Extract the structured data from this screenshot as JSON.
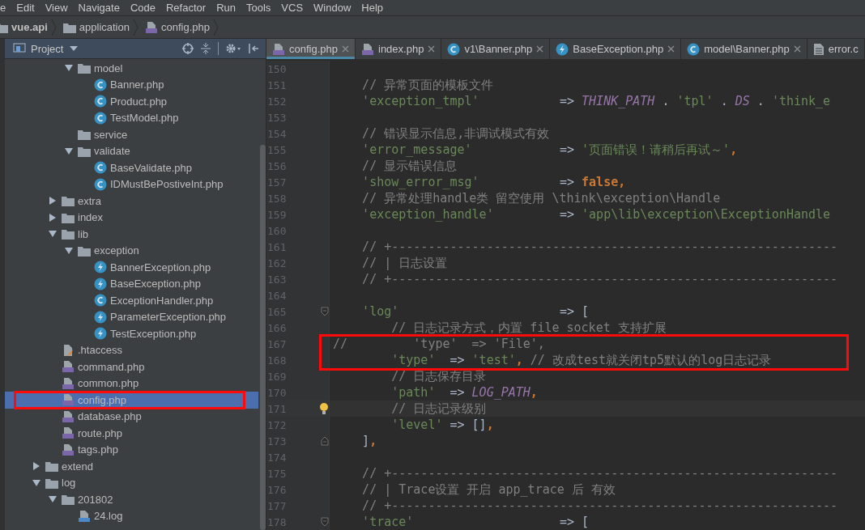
{
  "menu": [
    "e",
    "Edit",
    "View",
    "Navigate",
    "Code",
    "Refactor",
    "Run",
    "Tools",
    "VCS",
    "Window",
    "Help"
  ],
  "breadcrumb": [
    {
      "label": "vue.api",
      "kind": "project"
    },
    {
      "label": "application",
      "kind": "folder"
    },
    {
      "label": "config.php",
      "kind": "php"
    }
  ],
  "project_panel": {
    "title": "Project"
  },
  "tree": [
    {
      "children": [
        {
          "children": [
            {
              "label": "model",
              "kind": "folder",
              "expanded": true,
              "selected": false,
              "children": [
                {
                  "label": "Banner.php",
                  "kind": "class",
                  "selected": false
                },
                {
                  "label": "Product.php",
                  "kind": "class",
                  "selected": false
                },
                {
                  "label": "TestModel.php",
                  "kind": "class",
                  "selected": false
                }
              ]
            },
            {
              "label": "service",
              "kind": "folder",
              "selected": false
            },
            {
              "label": "validate",
              "kind": "folder",
              "expanded": true,
              "selected": false,
              "children": [
                {
                  "label": "BaseValidate.php",
                  "kind": "class",
                  "selected": false
                },
                {
                  "label": "IDMustBePostiveInt.php",
                  "kind": "class",
                  "selected": false
                }
              ]
            }
          ]
        },
        {
          "label": "extra",
          "kind": "folder",
          "expanded": false,
          "selected": false
        },
        {
          "label": "index",
          "kind": "folder",
          "expanded": false,
          "selected": false
        },
        {
          "label": "lib",
          "kind": "folder",
          "expanded": true,
          "selected": false,
          "children": [
            {
              "label": "exception",
              "kind": "folder",
              "expanded": true,
              "selected": false,
              "children": [
                {
                  "label": "BannerException.php",
                  "kind": "exception",
                  "selected": false
                },
                {
                  "label": "BaseException.php",
                  "kind": "exception",
                  "selected": false
                },
                {
                  "label": "ExceptionHandler.php",
                  "kind": "class",
                  "selected": false
                },
                {
                  "label": "ParameterException.php",
                  "kind": "exception",
                  "selected": false
                },
                {
                  "label": "TestException.php",
                  "kind": "exception",
                  "selected": false
                }
              ]
            }
          ]
        },
        {
          "label": ".htaccess",
          "kind": "htaccess",
          "selected": false
        },
        {
          "label": "command.php",
          "kind": "php",
          "selected": false
        },
        {
          "label": "common.php",
          "kind": "php",
          "selected": false
        },
        {
          "label": "config.php",
          "kind": "php",
          "selected": true,
          "boxed": true
        },
        {
          "label": "database.php",
          "kind": "php",
          "selected": false
        },
        {
          "label": "route.php",
          "kind": "php",
          "selected": false
        },
        {
          "label": "tags.php",
          "kind": "php",
          "selected": false
        }
      ]
    },
    {
      "label": "extend",
      "kind": "folder",
      "expanded": false,
      "selected": false
    },
    {
      "label": "log",
      "kind": "folder",
      "expanded": true,
      "selected": false,
      "children": [
        {
          "label": "201802",
          "kind": "folder",
          "expanded": true,
          "selected": false,
          "children": [
            {
              "label": "24.log",
              "kind": "log",
              "selected": false
            }
          ]
        }
      ]
    }
  ],
  "tabs": [
    {
      "label": "config.php",
      "kind": "php",
      "selected": true
    },
    {
      "label": "index.php",
      "kind": "php",
      "selected": false
    },
    {
      "label": "v1\\Banner.php",
      "kind": "class",
      "selected": false
    },
    {
      "label": "BaseException.php",
      "kind": "exception",
      "selected": false
    },
    {
      "label": "model\\Banner.php",
      "kind": "class",
      "selected": false
    },
    {
      "label": "error.c",
      "kind": "text",
      "selected": false
    }
  ],
  "code": [
    {
      "number": "150"
    },
    {
      "number": "151",
      "tokens": [
        {
          "kind": "comment",
          "text": "    // 异常页面的模板文件"
        }
      ]
    },
    {
      "number": "152",
      "tokens": [
        {
          "kind": "string",
          "text": "    'exception_tmpl'"
        },
        {
          "kind": "plain",
          "text": "           => "
        },
        {
          "kind": "const",
          "text": "THINK_PATH"
        },
        {
          "kind": "plain",
          "text": " . "
        },
        {
          "kind": "string",
          "text": "'tpl'"
        },
        {
          "kind": "plain",
          "text": " . "
        },
        {
          "kind": "const",
          "text": "DS"
        },
        {
          "kind": "plain",
          "text": " . "
        },
        {
          "kind": "string",
          "text": "'think_e"
        }
      ]
    },
    {
      "number": "153"
    },
    {
      "number": "154",
      "tokens": [
        {
          "kind": "comment",
          "text": "    // 错误显示信息,非调试模式有效"
        }
      ]
    },
    {
      "number": "155",
      "tokens": [
        {
          "kind": "string",
          "text": "    'error_message'"
        },
        {
          "kind": "plain",
          "text": "            => "
        },
        {
          "kind": "string",
          "text": "'页面错误！请稍后再试～'"
        },
        {
          "kind": "keyword",
          "text": ","
        }
      ]
    },
    {
      "number": "156",
      "tokens": [
        {
          "kind": "comment",
          "text": "    // 显示错误信息"
        }
      ]
    },
    {
      "number": "157",
      "tokens": [
        {
          "kind": "string",
          "text": "    'show_error_msg'"
        },
        {
          "kind": "plain",
          "text": "           => "
        },
        {
          "kind": "keyword",
          "text": "false,"
        }
      ]
    },
    {
      "number": "158",
      "tokens": [
        {
          "kind": "comment",
          "text": "    // 异常处理handle类 留空使用 \\think\\exception\\Handle"
        }
      ]
    },
    {
      "number": "159",
      "tokens": [
        {
          "kind": "string",
          "text": "    'exception_handle'"
        },
        {
          "kind": "plain",
          "text": "         => "
        },
        {
          "kind": "string",
          "text": "'app\\lib\\exception\\ExceptionHandle"
        }
      ]
    },
    {
      "number": "160"
    },
    {
      "number": "161",
      "tokens": [
        {
          "kind": "comment",
          "text": "    // +-------------------------------------------------------------"
        }
      ]
    },
    {
      "number": "162",
      "tokens": [
        {
          "kind": "comment",
          "text": "    // | 日志设置"
        }
      ]
    },
    {
      "number": "163",
      "tokens": [
        {
          "kind": "comment",
          "text": "    // +-------------------------------------------------------------"
        }
      ]
    },
    {
      "number": "164"
    },
    {
      "number": "165",
      "kind": "fold_start",
      "tokens": [
        {
          "kind": "string",
          "text": "    'log'"
        },
        {
          "kind": "plain",
          "text": "                      => ["
        }
      ]
    },
    {
      "number": "166",
      "tokens": [
        {
          "kind": "comment",
          "text": "        // 日志记录方式，内置 file socket 支持扩展"
        }
      ]
    },
    {
      "number": "167",
      "boxed": true,
      "tokens": [
        {
          "kind": "comment",
          "text": "//         'type'  => 'File',"
        }
      ]
    },
    {
      "number": "168",
      "boxed": true,
      "tokens": [
        {
          "kind": "string",
          "text": "        'type'"
        },
        {
          "kind": "plain",
          "text": "  => "
        },
        {
          "kind": "string",
          "text": "'test'"
        },
        {
          "kind": "keyword",
          "text": ","
        },
        {
          "kind": "comment",
          "text": " // 改成test就关闭tp5默认的log日志记录"
        }
      ]
    },
    {
      "number": "169",
      "tokens": [
        {
          "kind": "comment",
          "text": "        // 日志保存目录"
        }
      ]
    },
    {
      "number": "170",
      "tokens": [
        {
          "kind": "string",
          "text": "        'path'"
        },
        {
          "kind": "plain",
          "text": "  => "
        },
        {
          "kind": "const",
          "text": "LOG_PATH"
        },
        {
          "kind": "keyword",
          "text": ","
        }
      ]
    },
    {
      "number": "171",
      "current": true,
      "intention": true,
      "tokens": [
        {
          "kind": "comment",
          "text": "        // 日志记录级别"
        }
      ]
    },
    {
      "number": "172",
      "tokens": [
        {
          "kind": "string",
          "text": "        'level'"
        },
        {
          "kind": "plain",
          "text": " => []"
        },
        {
          "kind": "keyword",
          "text": ","
        }
      ]
    },
    {
      "number": "173",
      "kind": "fold_end",
      "tokens": [
        {
          "kind": "plain",
          "text": "    ]"
        },
        {
          "kind": "keyword",
          "text": ","
        }
      ]
    },
    {
      "number": "174"
    },
    {
      "number": "175",
      "tokens": [
        {
          "kind": "comment",
          "text": "    // +-------------------------------------------------------------"
        }
      ]
    },
    {
      "number": "176",
      "tokens": [
        {
          "kind": "comment",
          "text": "    // | Trace设置 开启 app_trace 后 有效"
        }
      ]
    },
    {
      "number": "177",
      "tokens": [
        {
          "kind": "comment",
          "text": "    // +-------------------------------------------------------------"
        }
      ]
    },
    {
      "number": "178",
      "kind": "fold_start",
      "tokens": [
        {
          "kind": "string",
          "text": "    'trace'"
        },
        {
          "kind": "plain",
          "text": "                    => ["
        }
      ]
    }
  ]
}
